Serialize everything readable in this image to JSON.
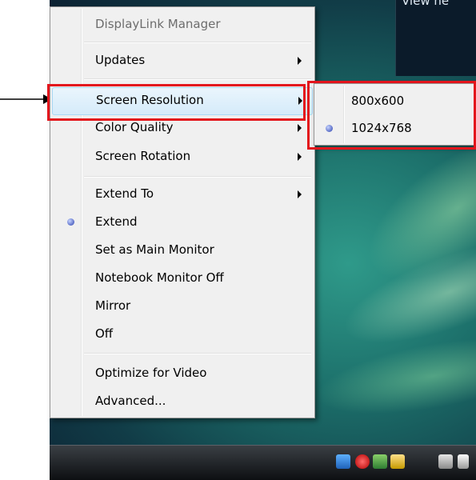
{
  "desktop": {
    "window_title": "View ne"
  },
  "menu": {
    "header": "DisplayLink Manager",
    "items": [
      {
        "label": "Updates"
      },
      {
        "label": "Screen Resolution"
      },
      {
        "label": "Color Quality"
      },
      {
        "label": "Screen Rotation"
      },
      {
        "label": "Extend To"
      },
      {
        "label": "Extend"
      },
      {
        "label": "Set as Main Monitor"
      },
      {
        "label": "Notebook Monitor Off"
      },
      {
        "label": "Mirror"
      },
      {
        "label": "Off"
      },
      {
        "label": "Optimize for Video"
      },
      {
        "label": "Advanced..."
      }
    ]
  },
  "submenu": {
    "items": [
      {
        "label": "800x600"
      },
      {
        "label": "1024x768"
      }
    ]
  },
  "colors": {
    "highlight": "#e3151c",
    "menu_background": "#f0f0f0",
    "hover": "#d5ebfa"
  }
}
